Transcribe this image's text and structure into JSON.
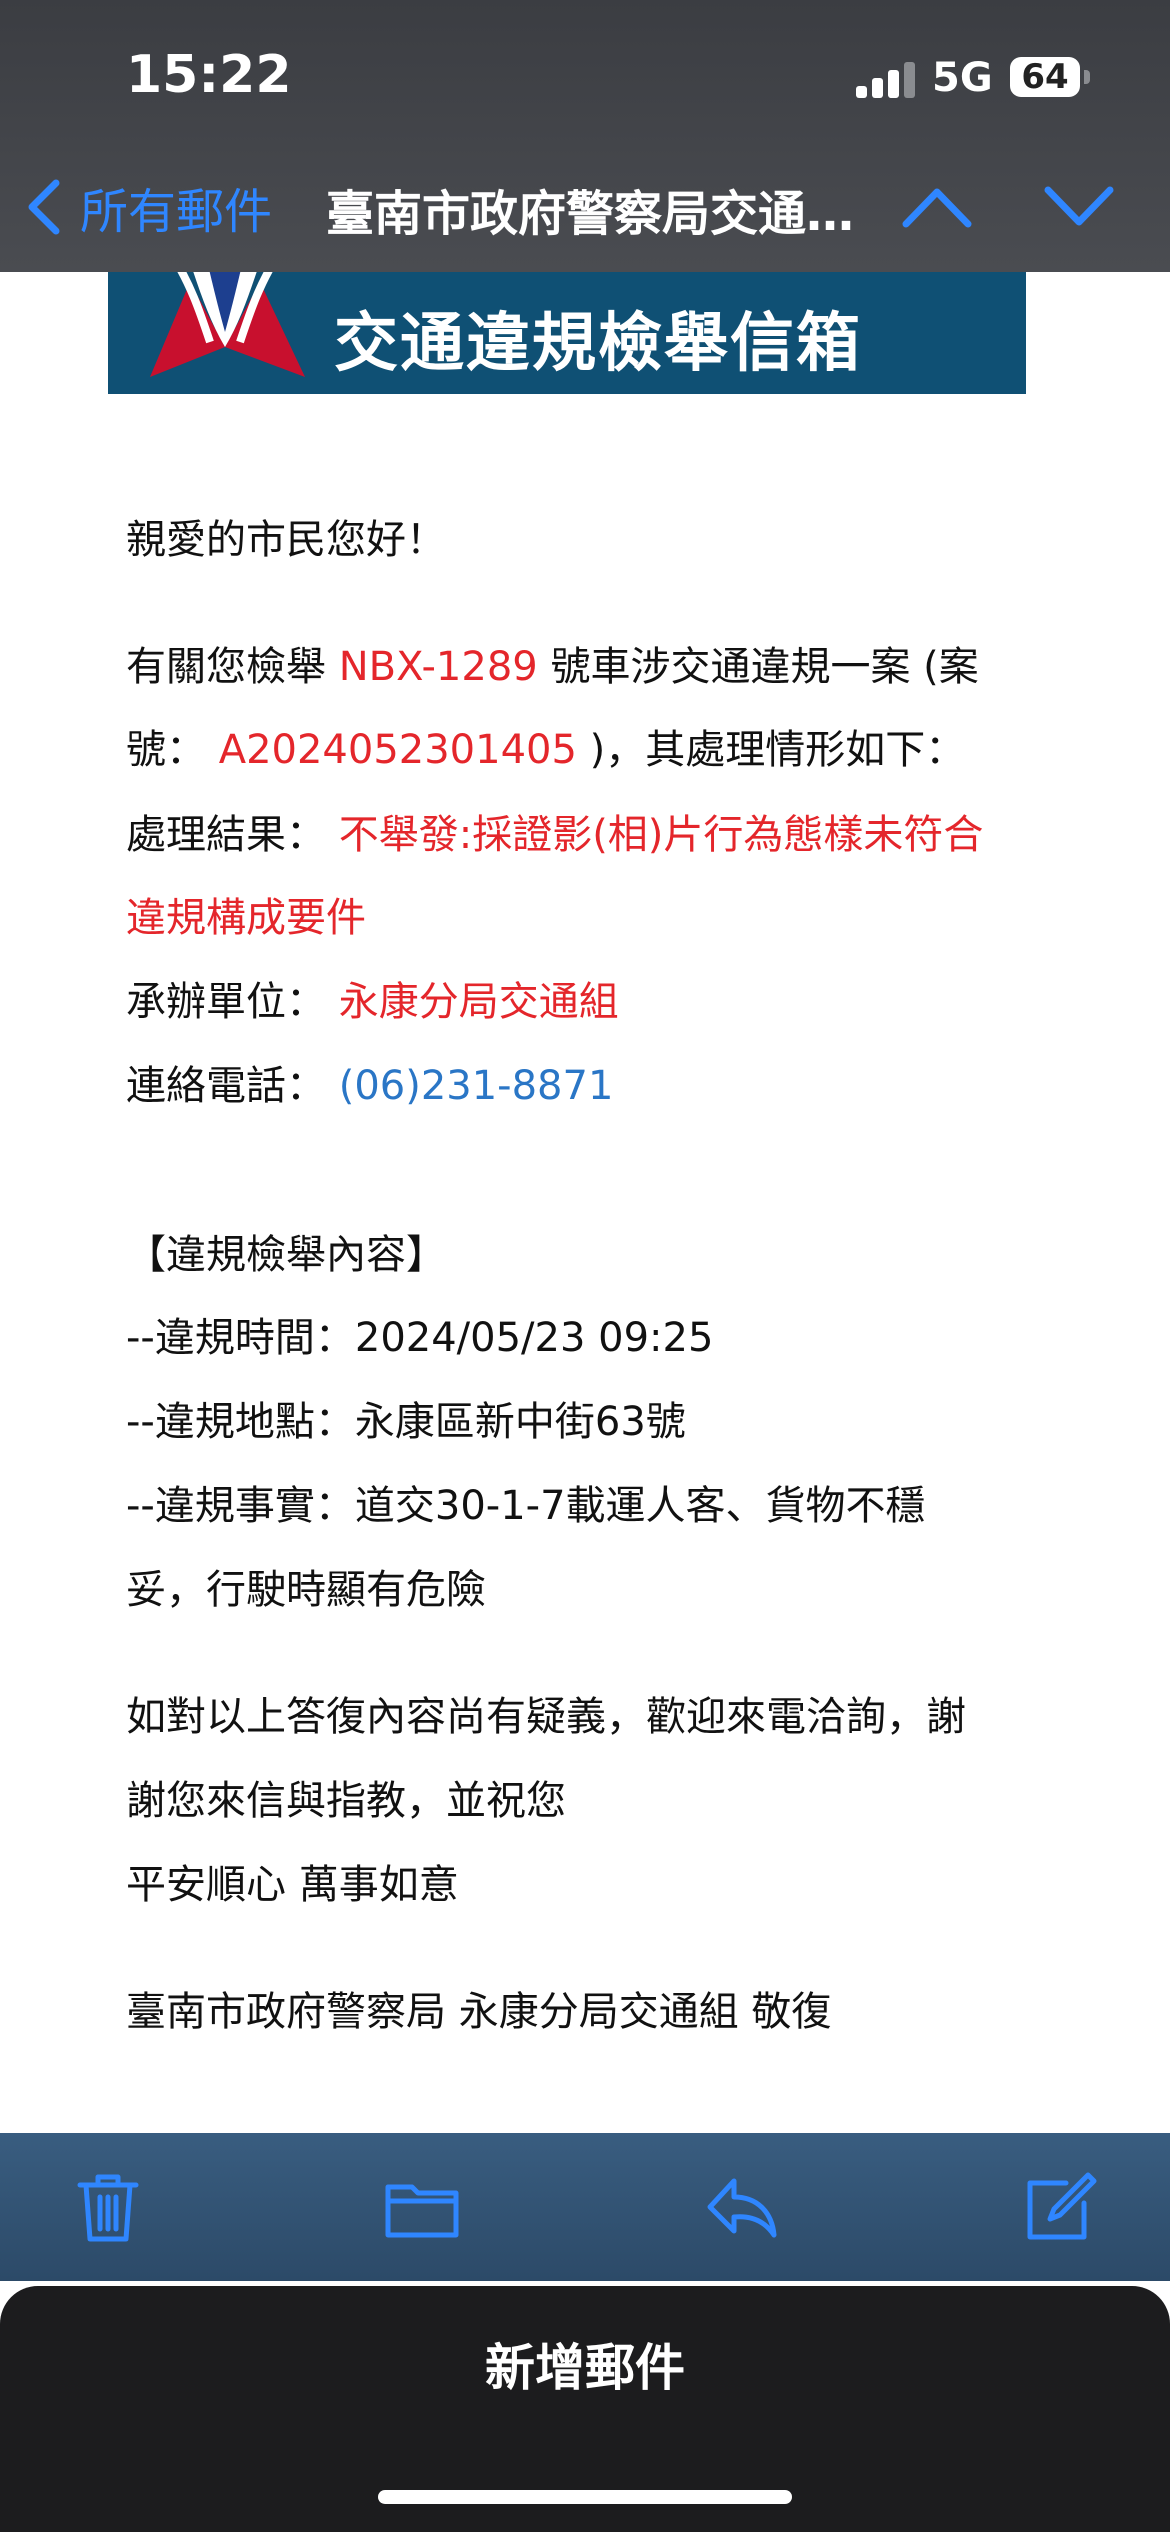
{
  "status_bar": {
    "time": "15:22",
    "network": "5G",
    "battery": "64"
  },
  "nav": {
    "back_label": "所有郵件",
    "title": "臺南市政府警察局交通違規檢舉信箱"
  },
  "banner": {
    "title": "交通違規檢舉信箱"
  },
  "email": {
    "greeting": "親愛的市民您好！",
    "intro_prefix": "有關您檢舉",
    "plate": "NBX-1289",
    "intro_suffix": "號車涉交通違規一案 (案",
    "case_label": "號：",
    "case_no": "A2024052301405",
    "case_suffix": ")，其處理情形如下：",
    "result_label": "處理結果：",
    "result_line1": "不舉發:採證影(相)片行為態樣未符合",
    "result_line2": "違規構成要件",
    "unit_label": "承辦單位：",
    "unit": "永康分局交通組",
    "phone_label": "連絡電話：",
    "phone": "(06)231-8871",
    "section_title": "【違規檢舉內容】",
    "time_line": "--違規時間：2024/05/23 09:25",
    "place_line": "--違規地點：永康區新中街63號",
    "fact_line1": "--違規事實：道交30-1-7載運人客、貨物不穩",
    "fact_line2": "妥，行駛時顯有危險",
    "closing1": "如對以上答復內容尚有疑義，歡迎來電洽詢，謝",
    "closing2": "謝您來信與指教，並祝您",
    "closing3": "平安順心 萬事如意",
    "signature": "臺南市政府警察局 永康分局交通組 敬復"
  },
  "sheet": {
    "title": "新增郵件"
  },
  "icons": {
    "trash": "trash-icon",
    "folder": "folder-icon",
    "reply": "reply-icon",
    "compose": "compose-icon"
  },
  "colors": {
    "accent": "#2f86ff",
    "red_text": "#e4262b",
    "link": "#2a76c6",
    "banner": "#0f5074"
  }
}
